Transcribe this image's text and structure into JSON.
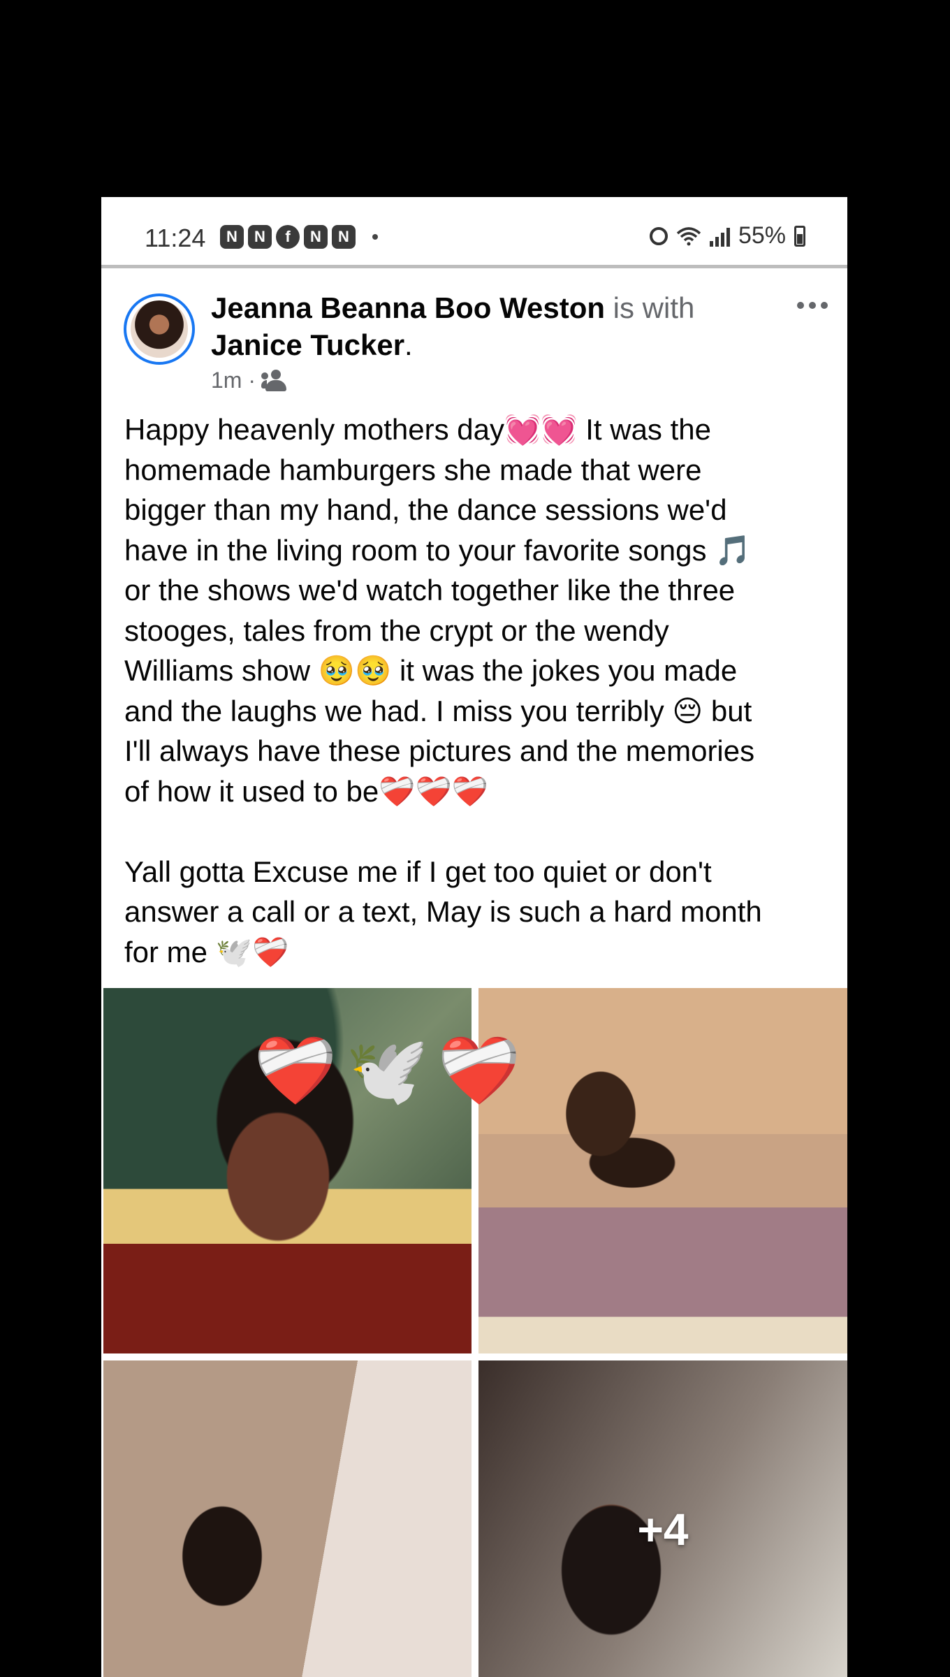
{
  "status_bar": {
    "time": "11:24",
    "notification_icons": [
      "N",
      "N",
      "f",
      "N",
      "N"
    ],
    "battery": "55%"
  },
  "post": {
    "author": "Jeanna Beanna Boo Weston",
    "with_text": " is with ",
    "tagged": "Janice Tucker",
    "period": ".",
    "timestamp": "1m · ",
    "audience_icon": "friends-icon",
    "text": "Happy heavenly mothers day💓💓 It was the\nhomemade hamburgers she made that were\nbigger than my hand, the dance sessions we'd\nhave in the living room to your favorite songs 🎵\nor the shows we'd watch together like the three\nstooges, tales from the crypt or the wendy\nWilliams show 🥹🥹 it was the jokes you made\nand the laughs we had. I miss you terribly 😔 but\nI'll always have these pictures and the memories\nof how it used to be❤️‍🩹❤️‍🩹❤️‍🩹\n\nYall gotta Excuse me if I get too quiet or don't\nanswer a call or a text, May is such a hard month\nfor me 🕊️❤️‍🩹",
    "photo_overlay_emoji": "❤️‍🩹🕊️❤️‍🩹",
    "more_photos": "+4"
  },
  "colors": {
    "accent": "#1877f2",
    "text": "#050505",
    "muted": "#65676b"
  }
}
